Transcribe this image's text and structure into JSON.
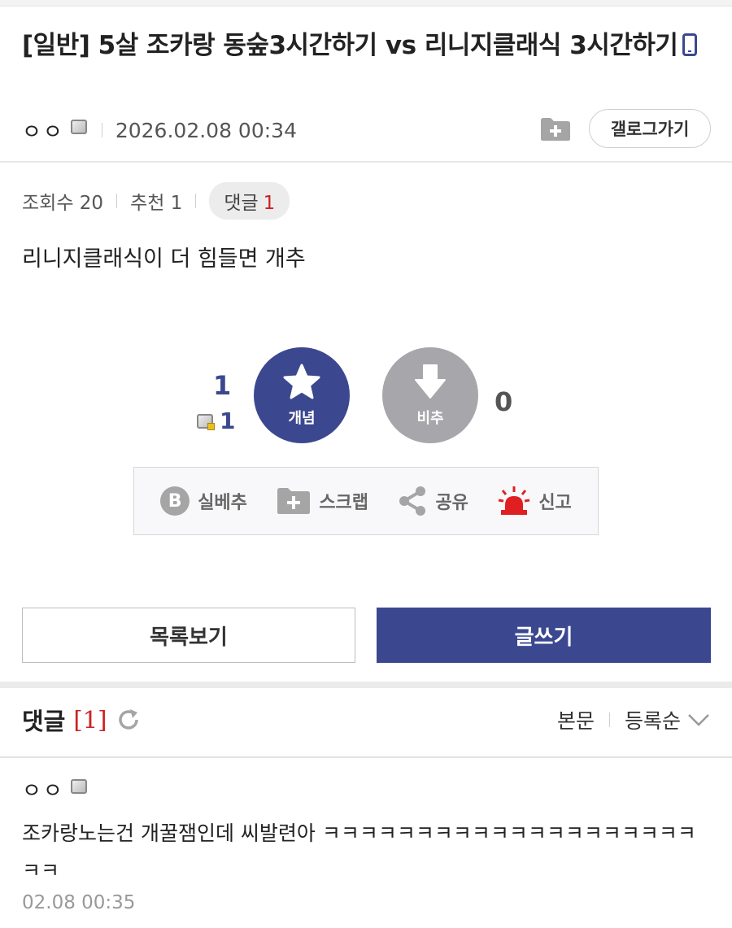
{
  "post": {
    "title": "[일반] 5살 조카랑 동숲3시간하기 vs 리니지클래식 3시간하기",
    "author": "ㅇㅇ",
    "date": "2026.02.08 00:34",
    "gallery_button": "갤로그가기",
    "views_label": "조회수 20",
    "recommend_label": "추천 1",
    "comment_pill_label": "댓글",
    "comment_pill_count": "1",
    "body": "리니지클래식이 더 힘들면 개추"
  },
  "vote": {
    "up_count": "1",
    "fix_count": "1",
    "up_label": "개념",
    "down_label": "비추",
    "down_count": "0"
  },
  "actions": {
    "best": "실베추",
    "scrap": "스크랩",
    "share": "공유",
    "report": "신고"
  },
  "buttons": {
    "list": "목록보기",
    "write": "글쓰기"
  },
  "comments_section": {
    "title": "댓글",
    "count": "[1]",
    "view_body": "본문",
    "sort": "등록순",
    "items": [
      {
        "author": "ㅇㅇ",
        "text": "조카랑노는건 개꿀잼인데 씨발련아 ㅋㅋㅋㅋㅋㅋㅋㅋㅋㅋㅋㅋㅋㅋㅋㅋㅋㅋㅋㅋㅋㅋ",
        "date": "02.08 00:35"
      }
    ]
  },
  "colors": {
    "accent": "#3b4890",
    "downvote": "#a6a6ab",
    "count_red": "#cc2222",
    "report_red": "#e02020"
  },
  "icons": {
    "mobile": "mobile-icon",
    "folder_add": "folder-add-icon",
    "star": "star-icon",
    "down_arrow": "down-arrow-icon",
    "best": "b-circle-icon",
    "scrap": "folder-plus-icon",
    "share": "share-icon",
    "report": "siren-icon",
    "refresh": "refresh-icon",
    "chevron": "chevron-down-icon"
  }
}
